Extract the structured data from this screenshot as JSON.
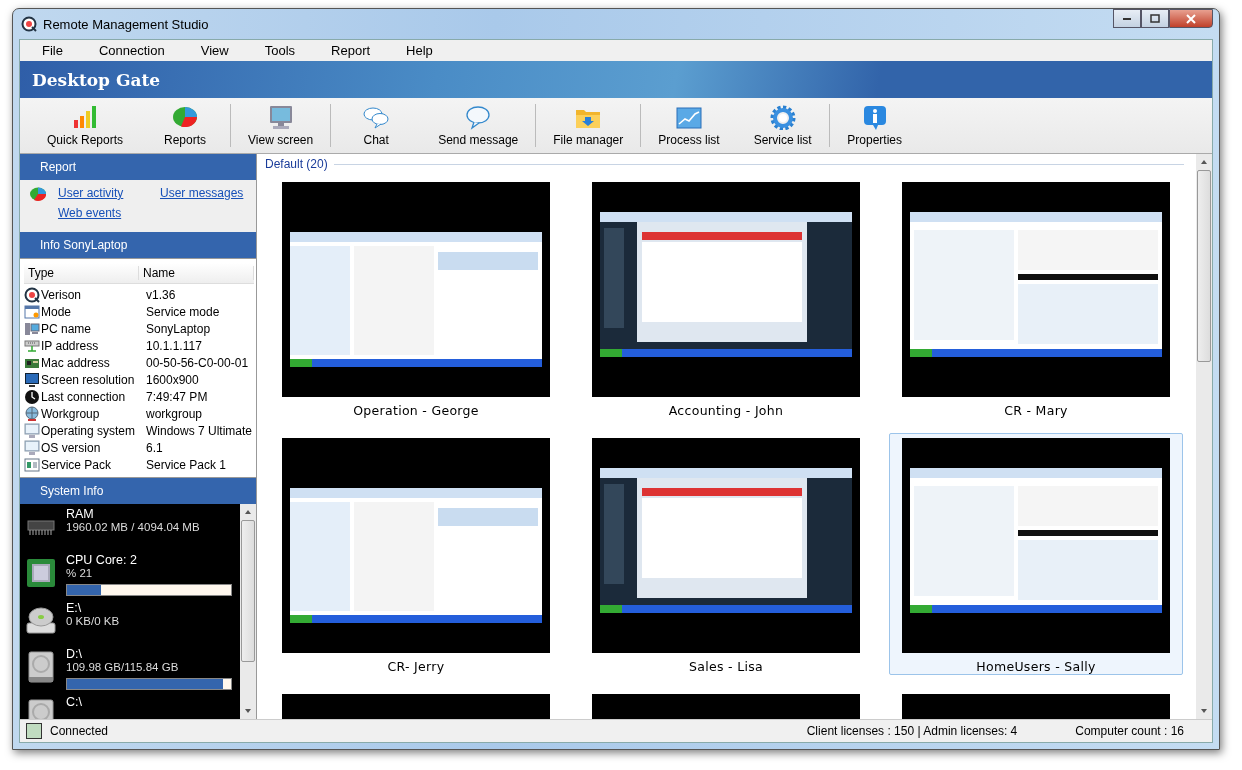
{
  "window": {
    "title": "Remote Management Studio"
  },
  "menu": [
    "File",
    "Connection",
    "View",
    "Tools",
    "Report",
    "Help"
  ],
  "header": {
    "title": "Desktop Gate"
  },
  "toolbar": {
    "groups": [
      [
        {
          "label": "Quick Reports",
          "kind": "bars"
        },
        {
          "label": "Reports",
          "kind": "pie"
        }
      ],
      [
        {
          "label": "View screen",
          "kind": "monitor"
        }
      ],
      [
        {
          "label": "Chat",
          "kind": "chat"
        },
        {
          "label": "Send message",
          "kind": "bubble"
        }
      ],
      [
        {
          "label": "File manager",
          "kind": "folder"
        }
      ],
      [
        {
          "label": "Process list",
          "kind": "graph"
        },
        {
          "label": "Service list",
          "kind": "gear"
        }
      ],
      [
        {
          "label": "Properties",
          "kind": "info"
        }
      ]
    ]
  },
  "report_panel": {
    "title": "Report",
    "links": [
      "User activity",
      "User messages",
      "Web events"
    ]
  },
  "info_panel": {
    "title": "Info SonyLaptop",
    "columns": [
      "Type",
      "Name"
    ],
    "rows": [
      {
        "kind": "logo",
        "type": "Verison",
        "name": "v1.36"
      },
      {
        "kind": "window",
        "type": "Mode",
        "name": "Service mode"
      },
      {
        "kind": "pc",
        "type": "PC name",
        "name": "SonyLaptop"
      },
      {
        "kind": "network",
        "type": "IP address",
        "name": "10.1.1.117"
      },
      {
        "kind": "card",
        "type": "Mac address",
        "name": "00-50-56-C0-00-01"
      },
      {
        "kind": "monitor",
        "type": "Screen resolution",
        "name": "1600x900"
      },
      {
        "kind": "clock",
        "type": "Last connection",
        "name": "7:49:47 PM"
      },
      {
        "kind": "globe",
        "type": "Workgroup",
        "name": "workgroup"
      },
      {
        "kind": "display",
        "type": "Operating system",
        "name": "Windows 7 Ultimate"
      },
      {
        "kind": "display",
        "type": "OS version",
        "name": "6.1"
      },
      {
        "kind": "panel",
        "type": "Service Pack",
        "name": "Service Pack 1"
      }
    ]
  },
  "system_panel": {
    "title": "System Info",
    "items": [
      {
        "kind": "ram",
        "title": "RAM",
        "detail": "1960.02 MB / 4094.04 MB"
      },
      {
        "kind": "cpu",
        "title": "CPU Core: 2",
        "detail": "% 21",
        "level": 0.21
      },
      {
        "kind": "cd",
        "title": "E:\\",
        "detail": "0 KB/0 KB"
      },
      {
        "kind": "hdd",
        "title": "D:\\",
        "detail": "109.98 GB/115.84 GB",
        "level": 0.95
      },
      {
        "kind": "hdd",
        "title": "C:\\"
      }
    ]
  },
  "group": {
    "title": "Default (20)"
  },
  "thumbnails": [
    {
      "name": "Operation - George",
      "selected": false
    },
    {
      "name": "Accounting - John",
      "selected": false
    },
    {
      "name": "CR - Mary",
      "selected": false
    },
    {
      "name": "CR- Jerry",
      "selected": false
    },
    {
      "name": "Sales - Lisa",
      "selected": false
    },
    {
      "name": "HomeUsers - Sally",
      "selected": true
    },
    {
      "selected": false
    },
    {
      "selected": false
    },
    {
      "selected": false
    }
  ],
  "status_bar": {
    "connection": "Connected",
    "licenses": "Client licenses : 150 | Admin licenses: 4",
    "count": "Computer count : 16"
  }
}
